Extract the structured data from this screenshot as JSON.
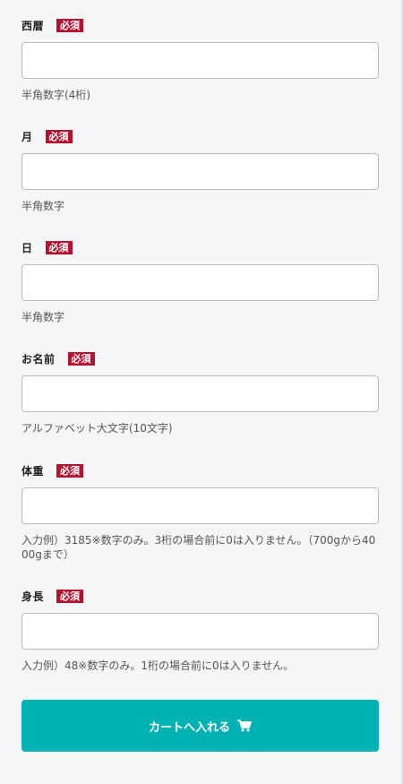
{
  "fields": [
    {
      "label": "西暦",
      "required_badge": "必須",
      "value": "",
      "help": "半角数字(4桁)"
    },
    {
      "label": "月",
      "required_badge": "必須",
      "value": "",
      "help": "半角数字"
    },
    {
      "label": "日",
      "required_badge": "必須",
      "value": "",
      "help": "半角数字"
    },
    {
      "label": "お名前",
      "required_badge": "必須",
      "value": "",
      "help": "アルファベット大文字(10文字)"
    },
    {
      "label": "体重",
      "required_badge": "必須",
      "value": "",
      "help": "入力例）3185※数字のみ。3桁の場合前に0は入りません。（700gから4000gまで）"
    },
    {
      "label": "身長",
      "required_badge": "必須",
      "value": "",
      "help": "入力例）48※数字のみ。1桁の場合前に0は入りません。"
    }
  ],
  "cart_button": {
    "label": "カートへ入れる",
    "icon": "cart-icon"
  },
  "colors": {
    "background": "#f5f6f8",
    "required_badge": "#b5122f",
    "cart_button": "#00b2b2"
  }
}
